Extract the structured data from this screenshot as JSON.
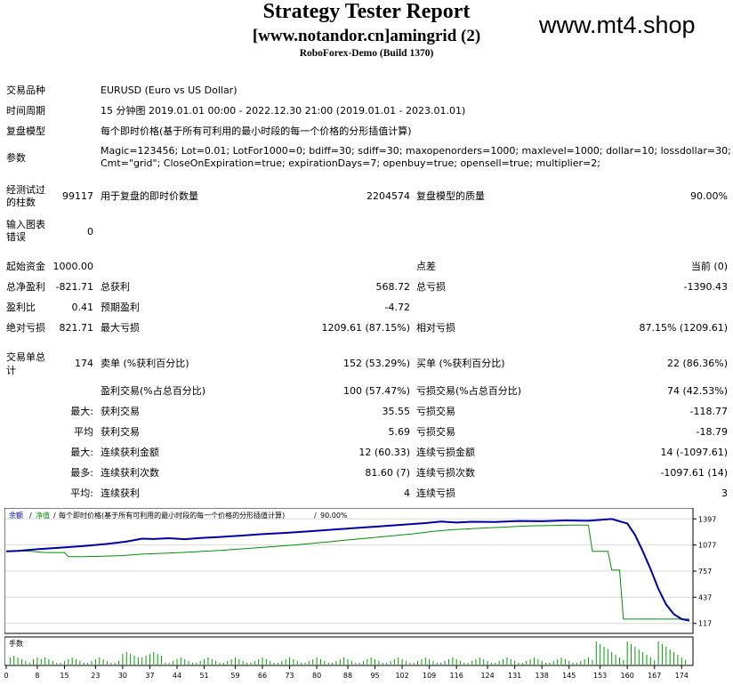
{
  "header": {
    "title": "Strategy Tester Report",
    "subtitle": "[www.notandor.cn]amingrid (2)",
    "server": "RoboForex-Demo (Build 1370)",
    "watermark": "www.mt4.shop"
  },
  "settings": {
    "symbol_label": "交易品种",
    "symbol_value": "EURUSD (Euro vs US Dollar)",
    "period_label": "时间周期",
    "period_value": "15 分钟图 2019.01.01 00:00 - 2022.12.30 21:00 (2019.01.01 - 2023.01.01)",
    "model_label": "复盘模型",
    "model_value": "每个即时价格(基于所有可利用的最小时段的每一个价格的分形插值计算)",
    "params_label": "参数",
    "params_line1": "Magic=123456; Lot=0.01; LotFor1000=0; bdiff=30; sdiff=30; maxopenorders=1000; maxlevel=1000; dollar=10; lossdollar=30;",
    "params_line2": "Cmt=\"grid\"; CloseOnExpiration=true; expirationDays=7; openbuy=true; opensell=true; multiplier=2;"
  },
  "bars": {
    "bars_label_1": "经测试过",
    "bars_label_2": "的柱数",
    "bars_value": "99117",
    "ticks_label": "用于复盘的即时价数量",
    "ticks_value": "2204574",
    "quality_label": "复盘模型的质量",
    "quality_value": "90.00%",
    "errors_label_1": "输入图表",
    "errors_label_2": "错误",
    "errors_value": "0"
  },
  "stats": {
    "deposit_label": "起始资金",
    "deposit_value": "1000.00",
    "spread_label": "点差",
    "spread_value": "当前 (0)",
    "netprofit_label": "总净盈利",
    "netprofit_value": "-821.71",
    "grossprofit_label": "总获利",
    "grossprofit_value": "568.72",
    "grossloss_label": "总亏损",
    "grossloss_value": "-1390.43",
    "pf_label": "盈利比",
    "pf_value": "0.41",
    "expected_label": "预期盈利",
    "expected_value": "-4.72",
    "absdd_label": "绝对亏损",
    "absdd_value": "821.71",
    "maxdd_label": "最大亏损",
    "maxdd_value": "1209.61 (87.15%)",
    "reldd_label": "相对亏损",
    "reldd_value": "87.15% (1209.61)",
    "trades_label_1": "交易单总",
    "trades_label_2": "计",
    "trades_value": "174",
    "short_label": "卖单 (%获利百分比)",
    "short_value": "152 (53.29%)",
    "long_label": "买单 (%获利百分比)",
    "long_value": "22 (86.36%)",
    "profit_trades_label": "盈利交易(%占总百分比)",
    "profit_trades_value": "100 (57.47%)",
    "loss_trades_label": "亏损交易(%占总百分比)",
    "loss_trades_value": "74 (42.53%)",
    "largest_label": "最大:",
    "largest_profit_label": "获利交易",
    "largest_profit_value": "35.55",
    "largest_loss_label": "亏损交易",
    "largest_loss_value": "-118.77",
    "average_label": "平均",
    "average_profit_label": "获利交易",
    "average_profit_value": "5.69",
    "average_loss_label": "亏损交易",
    "average_loss_value": "-18.79",
    "maxcons_label": "最大:",
    "maxcons_wins_label": "连续获利金额",
    "maxcons_wins_value": "12 (60.33)",
    "maxcons_losses_label": "连续亏损金额",
    "maxcons_losses_value": "14 (-1097.61)",
    "maxconsamt_label": "最多:",
    "maxconsamt_profit_label": "连续获利次数",
    "maxconsamt_profit_value": "81.60 (7)",
    "maxconsamt_loss_label": "连续亏损次数",
    "maxconsamt_loss_value": "-1097.61 (14)",
    "avgcons_label": "平均:",
    "avgcons_wins_label": "连续获利",
    "avgcons_wins_value": "4",
    "avgcons_losses_label": "连续亏损",
    "avgcons_losses_value": "3"
  },
  "chart_data": {
    "type": "line",
    "legend": {
      "balance": "余额",
      "sep1": "/",
      "equity": "净值",
      "sep2": "/",
      "text": "每个即时价格(基于所有可利用的最小时段的每一个价格的分形插值计算)",
      "sep3": "/",
      "quality": "90.00%"
    },
    "ylim": [
      27,
      1487
    ],
    "yticks": [
      "1397",
      "1077",
      "757",
      "437",
      "117"
    ],
    "xticks": [
      "0",
      "8",
      "15",
      "23",
      "30",
      "37",
      "44",
      "51",
      "59",
      "66",
      "73",
      "80",
      "88",
      "95",
      "102",
      "109",
      "116",
      "124",
      "131",
      "138",
      "145",
      "153",
      "160",
      "167",
      "174"
    ],
    "xlim": [
      0,
      176
    ],
    "series": [
      {
        "name": "余额",
        "color": "#0000a0",
        "x": [
          0,
          3,
          8,
          14,
          20,
          26,
          31,
          35,
          38,
          42,
          46,
          50,
          55,
          60,
          66,
          72,
          78,
          84,
          90,
          96,
          102,
          108,
          112,
          116,
          120,
          126,
          132,
          138,
          144,
          150,
          156,
          160,
          162,
          164,
          166,
          168,
          170,
          172,
          174,
          176
        ],
        "y": [
          1000,
          1005,
          1025,
          1045,
          1065,
          1090,
          1120,
          1155,
          1150,
          1160,
          1148,
          1162,
          1175,
          1190,
          1210,
          1225,
          1245,
          1265,
          1285,
          1305,
          1325,
          1345,
          1365,
          1352,
          1362,
          1358,
          1372,
          1368,
          1378,
          1374,
          1395,
          1340,
          1200,
          1000,
          780,
          540,
          350,
          230,
          170,
          150
        ]
      },
      {
        "name": "净值",
        "color": "#009000",
        "x": [
          0,
          5,
          10,
          15,
          16,
          20,
          25,
          30,
          35,
          45,
          55,
          65,
          75,
          85,
          95,
          105,
          110,
          115,
          125,
          135,
          145,
          150,
          151,
          155,
          156,
          158,
          159,
          162,
          163,
          176
        ],
        "y": [
          1000,
          1005,
          985,
          985,
          935,
          935,
          940,
          948,
          965,
          985,
          1010,
          1045,
          1080,
          1125,
          1170,
          1215,
          1245,
          1265,
          1290,
          1312,
          1320,
          1320,
          1000,
          1000,
          770,
          770,
          170,
          170,
          170,
          170
        ]
      }
    ],
    "volume_label": "手数"
  }
}
